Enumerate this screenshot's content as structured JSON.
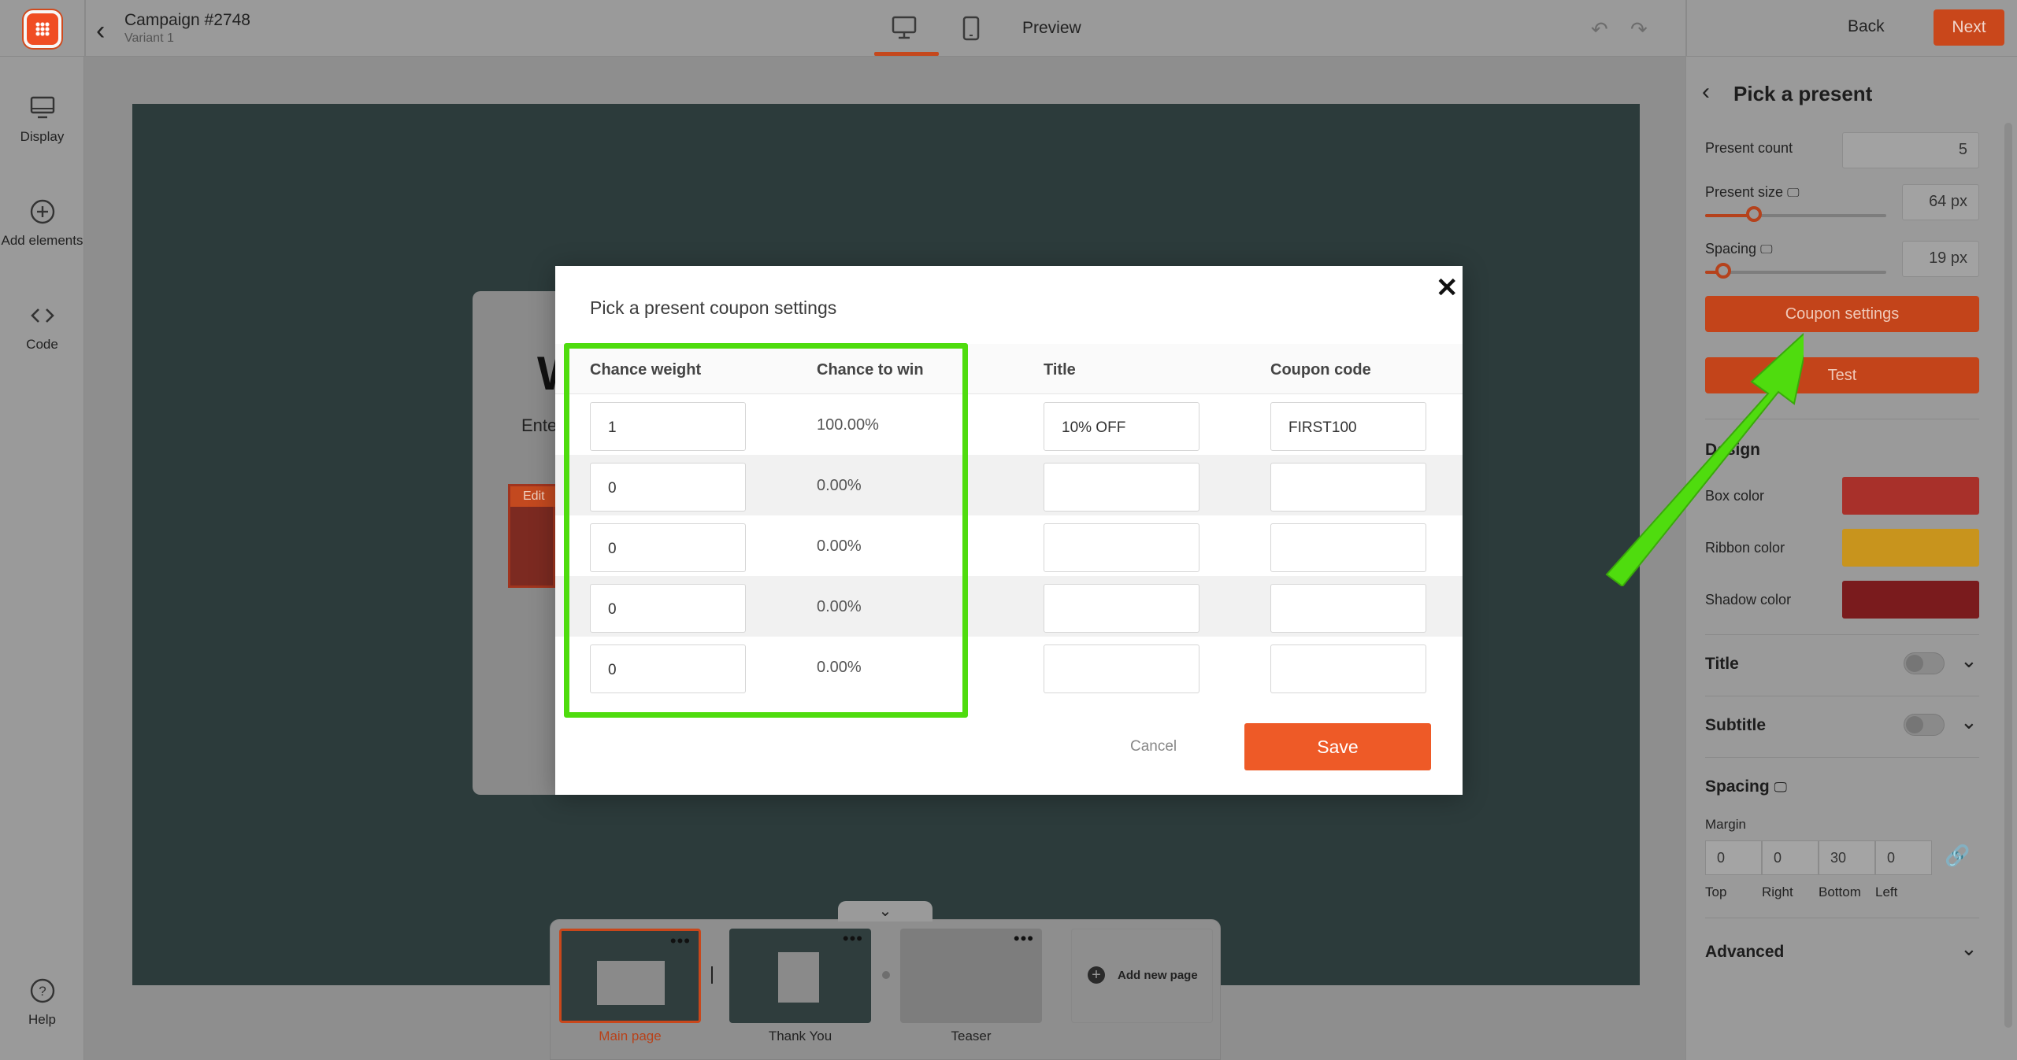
{
  "topbar": {
    "campaign_title": "Campaign #2748",
    "variant": "Variant 1",
    "preview_label": "Preview",
    "back_label": "Back",
    "next_label": "Next"
  },
  "sidebar": {
    "items": [
      {
        "label": "Display",
        "icon": "display-icon"
      },
      {
        "label": "Add elements",
        "icon": "plus-circle-icon"
      },
      {
        "label": "Code",
        "icon": "code-icon"
      },
      {
        "label": "Help",
        "icon": "help-icon"
      }
    ]
  },
  "canvas": {
    "bg_heading_char": "W",
    "bg_text": "Ente",
    "bg_edit_label": "Edit"
  },
  "pages": {
    "items": [
      {
        "label": "Main page",
        "active": true
      },
      {
        "label": "Thank You",
        "active": false
      },
      {
        "label": "Teaser",
        "active": false
      }
    ],
    "add_label": "Add new page"
  },
  "modal": {
    "title": "Pick a present coupon settings",
    "columns": [
      "Chance weight",
      "Chance to win",
      "Title",
      "Coupon code"
    ],
    "rows": [
      {
        "weight": "1",
        "chance": "100.00%",
        "title": "10% OFF",
        "code": "FIRST100"
      },
      {
        "weight": "0",
        "chance": "0.00%",
        "title": "",
        "code": ""
      },
      {
        "weight": "0",
        "chance": "0.00%",
        "title": "",
        "code": ""
      },
      {
        "weight": "0",
        "chance": "0.00%",
        "title": "",
        "code": ""
      },
      {
        "weight": "0",
        "chance": "0.00%",
        "title": "",
        "code": ""
      }
    ],
    "cancel_label": "Cancel",
    "save_label": "Save"
  },
  "panel": {
    "title": "Pick a present",
    "present_count_label": "Present count",
    "present_count_value": "5",
    "present_size_label": "Present size",
    "present_size_value": "64 px",
    "present_size_level": 0.27,
    "spacing_label": "Spacing",
    "spacing_value": "19 px",
    "spacing_level": 0.1,
    "coupon_settings_label": "Coupon settings",
    "test_label": "Test",
    "design_heading": "Design",
    "box_color_label": "Box color",
    "ribbon_color_label": "Ribbon color",
    "shadow_color_label": "Shadow color",
    "title_heading": "Title",
    "subtitle_heading": "Subtitle",
    "spacing_heading": "Spacing",
    "margin_label": "Margin",
    "margin": [
      {
        "value": "0",
        "label": "Top"
      },
      {
        "value": "0",
        "label": "Right"
      },
      {
        "value": "30",
        "label": "Bottom"
      },
      {
        "value": "0",
        "label": "Left"
      }
    ],
    "advanced_heading": "Advanced"
  },
  "colors": {
    "accent": "#ee5a27",
    "highlight": "#4fdc0e",
    "box_color": "#a8302a",
    "ribbon_color": "#c8941d",
    "shadow_color": "#7a1b1d"
  }
}
